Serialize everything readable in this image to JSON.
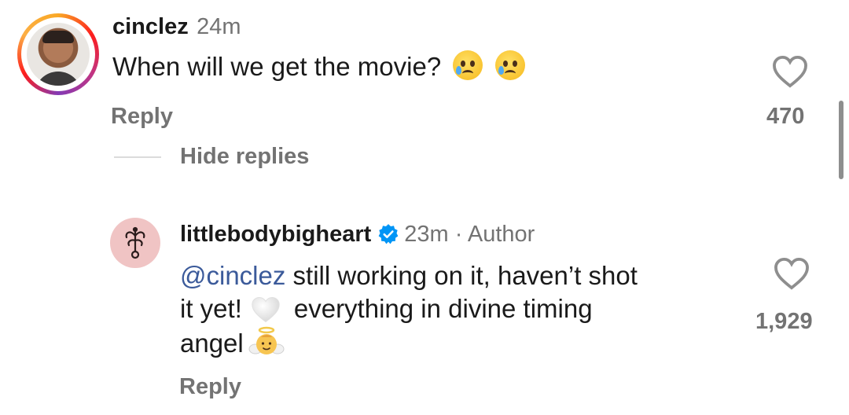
{
  "comment": {
    "username": "cinclez",
    "time": "24m",
    "text": "When will we get the movie?",
    "reply_label": "Reply",
    "like_count": "470",
    "hide_replies_label": "Hide replies"
  },
  "reply_comment": {
    "username": "littlebodybigheart",
    "meta": "23m · Author",
    "mention": "@cinclez",
    "line1": " still working on it, haven’t shot",
    "line2a": "it yet!",
    "line2b": "everything in divine timing",
    "line3": "angel",
    "reply_label": "Reply",
    "like_count": "1,929"
  },
  "icons": {
    "like": "heart-outline-icon",
    "crying": "crying-face-emoji",
    "white_heart": "white-heart-emoji",
    "angel": "baby-angel-emoji",
    "verified": "verified-badge-icon"
  },
  "colors": {
    "mention": "#3b5a9a",
    "verified": "#0095f6",
    "muted": "#737373"
  }
}
